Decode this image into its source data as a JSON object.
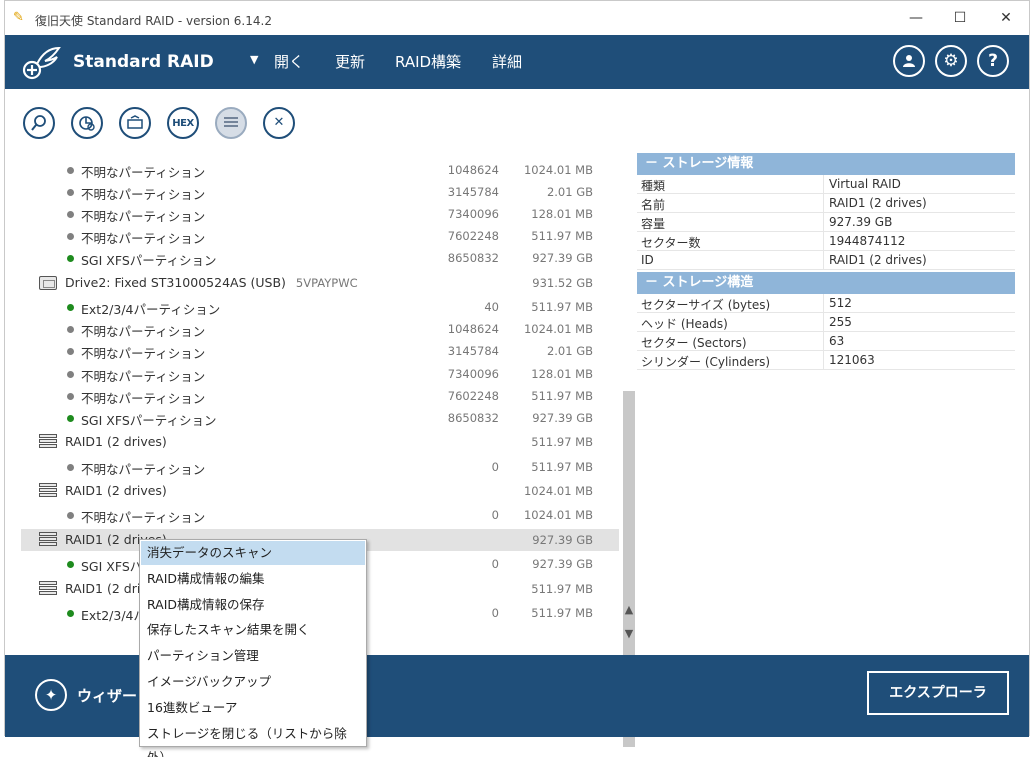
{
  "window": {
    "title": "復旧天使 Standard RAID - version 6.14.2",
    "min": "—",
    "max": "☐",
    "close": "✕"
  },
  "header": {
    "app_name": "Standard RAID",
    "menu_arrow": "▼",
    "menus": [
      "開く",
      "更新",
      "RAID構築",
      "詳細"
    ],
    "user_icon": "user-icon",
    "settings_icon": "gear-icon",
    "help_label": "?"
  },
  "toolbar": {
    "buttons": [
      {
        "name": "search",
        "icon": "search-icon"
      },
      {
        "name": "scan",
        "icon": "disk-scan-icon"
      },
      {
        "name": "raid",
        "icon": "raid-config-icon"
      },
      {
        "name": "hex",
        "label": "HEX"
      },
      {
        "name": "list",
        "icon": "list-icon"
      },
      {
        "name": "close",
        "icon": "close-icon"
      }
    ]
  },
  "tree": {
    "rows": [
      {
        "type": "part",
        "dot": "gray",
        "name": "不明なパーティション",
        "sector": "1048624",
        "size": "1024.01 MB"
      },
      {
        "type": "part",
        "dot": "gray",
        "name": "不明なパーティション",
        "sector": "3145784",
        "size": "2.01 GB"
      },
      {
        "type": "part",
        "dot": "gray",
        "name": "不明なパーティション",
        "sector": "7340096",
        "size": "128.01 MB"
      },
      {
        "type": "part",
        "dot": "gray",
        "name": "不明なパーティション",
        "sector": "7602248",
        "size": "511.97 MB"
      },
      {
        "type": "part",
        "dot": "green",
        "name": "SGI XFSパーティション",
        "sector": "8650832",
        "size": "927.39 GB"
      },
      {
        "type": "drive",
        "name": "Drive2: Fixed ST31000524AS (USB)",
        "serial": "5VPAYPWC",
        "sector": "",
        "size": "931.52 GB"
      },
      {
        "type": "part",
        "dot": "green",
        "name": "Ext2/3/4パーティション",
        "sector": "40",
        "size": "511.97 MB"
      },
      {
        "type": "part",
        "dot": "gray",
        "name": "不明なパーティション",
        "sector": "1048624",
        "size": "1024.01 MB"
      },
      {
        "type": "part",
        "dot": "gray",
        "name": "不明なパーティション",
        "sector": "3145784",
        "size": "2.01 GB"
      },
      {
        "type": "part",
        "dot": "gray",
        "name": "不明なパーティション",
        "sector": "7340096",
        "size": "128.01 MB"
      },
      {
        "type": "part",
        "dot": "gray",
        "name": "不明なパーティション",
        "sector": "7602248",
        "size": "511.97 MB"
      },
      {
        "type": "part",
        "dot": "green",
        "name": "SGI XFSパーティション",
        "sector": "8650832",
        "size": "927.39 GB"
      },
      {
        "type": "raid",
        "name": "RAID1 (2 drives)",
        "sector": "",
        "size": "511.97 MB"
      },
      {
        "type": "part",
        "dot": "gray",
        "name": "不明なパーティション",
        "sector": "0",
        "size": "511.97 MB"
      },
      {
        "type": "raid",
        "name": "RAID1 (2 drives)",
        "sector": "",
        "size": "1024.01 MB"
      },
      {
        "type": "part",
        "dot": "gray",
        "name": "不明なパーティション",
        "sector": "0",
        "size": "1024.01 MB"
      },
      {
        "type": "raid",
        "name": "RAID1 (2 drives)",
        "sector": "",
        "size": "927.39 GB",
        "selected": true
      },
      {
        "type": "part",
        "dot": "green",
        "name": "SGI XFSパ",
        "sector": "0",
        "size": "927.39 GB"
      },
      {
        "type": "raid",
        "name": "RAID1 (2 dri",
        "sector": "",
        "size": "511.97 MB"
      },
      {
        "type": "part",
        "dot": "green",
        "name": "Ext2/3/4パ",
        "sector": "0",
        "size": "511.97 MB"
      }
    ]
  },
  "info": {
    "storage_info": {
      "header": "－ ストレージ情報",
      "rows": [
        {
          "key": "種類",
          "value": "Virtual RAID"
        },
        {
          "key": "名前",
          "value": "RAID1 (2 drives)"
        },
        {
          "key": "容量",
          "value": "927.39 GB"
        },
        {
          "key": "セクター数",
          "value": "1944874112"
        },
        {
          "key": "ID",
          "value": "RAID1 (2 drives)"
        }
      ]
    },
    "storage_structure": {
      "header": "－ ストレージ構造",
      "rows": [
        {
          "key": "セクターサイズ (bytes)",
          "value": "512"
        },
        {
          "key": "ヘッド (Heads)",
          "value": "255"
        },
        {
          "key": "セクター (Sectors)",
          "value": "63"
        },
        {
          "key": "シリンダー (Cylinders)",
          "value": "121063"
        }
      ]
    }
  },
  "footer": {
    "wizard_label": "ウィザー",
    "explorer_label": "エクスプローラ"
  },
  "context_menu": {
    "items": [
      "消失データのスキャン",
      "RAID構成情報の編集",
      "RAID構成情報の保存",
      "保存したスキャン結果を開く",
      "パーティション管理",
      "イメージバックアップ",
      "16進数ビューア",
      "ストレージを閉じる（リストから除外）"
    ],
    "highlighted_index": 0
  }
}
